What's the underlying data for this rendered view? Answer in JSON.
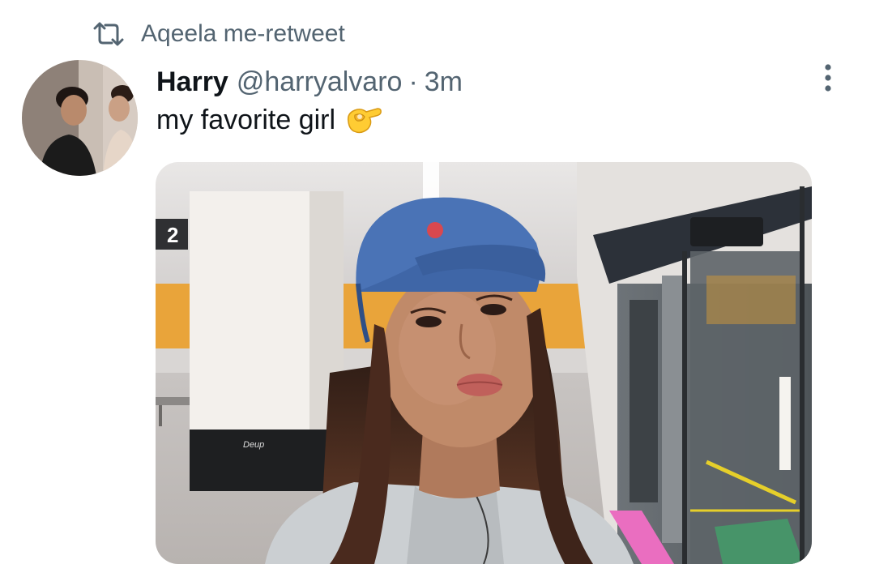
{
  "social_context": {
    "icon": "retweet-icon",
    "text": "Aqeela me-retweet"
  },
  "tweet": {
    "display_name": "Harry",
    "handle": "@harryalvaro",
    "separator": "·",
    "timestamp": "3m",
    "text": "my favorite girl",
    "emoji": "pinching-hand-emoji",
    "more_icon": "more-vertical-icon"
  },
  "media": {
    "platform_number": "2",
    "pillar_logo": "Deup"
  },
  "colors": {
    "secondary_text": "#536471",
    "primary_text": "#0f1419",
    "cap": "#4a73b6",
    "wall_orange": "#e9a43a"
  }
}
